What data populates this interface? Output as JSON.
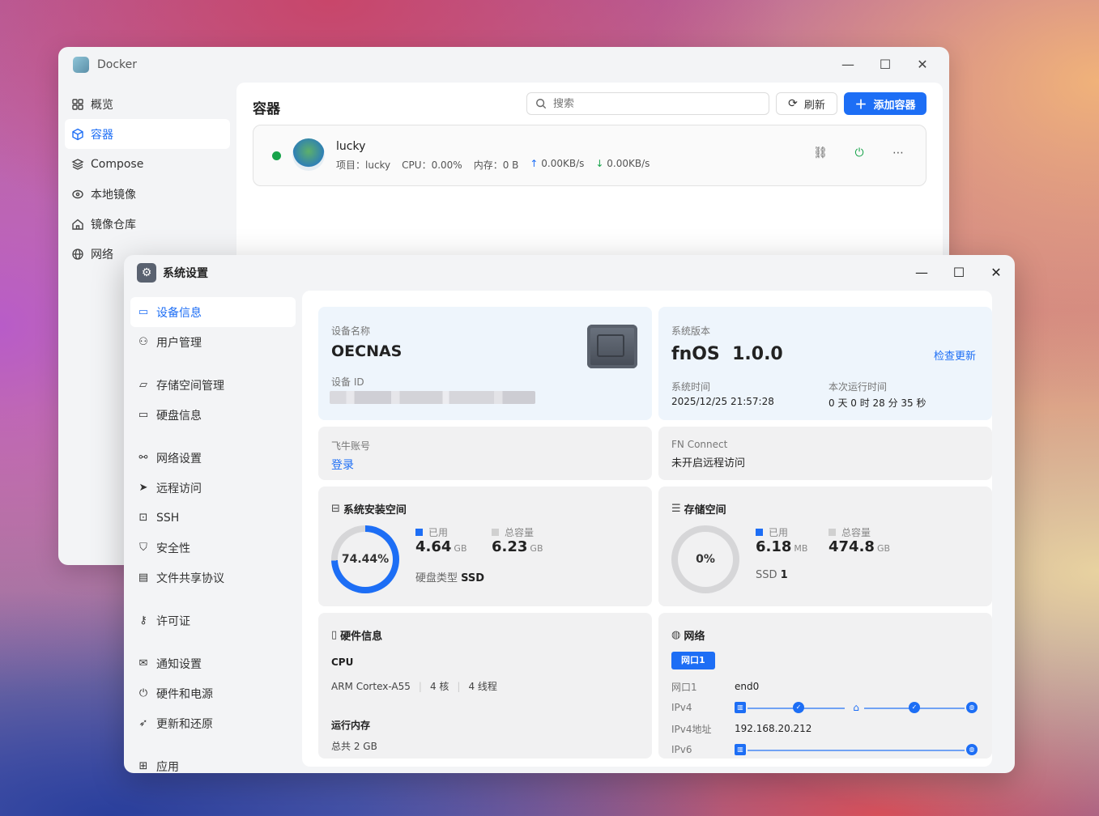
{
  "docker": {
    "title": "Docker",
    "nav": [
      {
        "label": "概览",
        "icon": "grid-icon"
      },
      {
        "label": "容器",
        "icon": "cube-icon",
        "active": true
      },
      {
        "label": "Compose",
        "icon": "layers-icon"
      },
      {
        "label": "本地镜像",
        "icon": "disc-icon"
      },
      {
        "label": "镜像仓库",
        "icon": "home-icon"
      },
      {
        "label": "网络",
        "icon": "globe-icon"
      }
    ],
    "heading": "容器",
    "search_placeholder": "搜索",
    "refresh_label": "刷新",
    "add_label": "添加容器",
    "container": {
      "name": "lucky",
      "project": "项目：lucky",
      "cpu": "CPU：0.00%",
      "memory": "内存：0 B",
      "upload": "0.00KB/s",
      "download": "0.00KB/s",
      "status_color": "#17a34a"
    }
  },
  "settings": {
    "title": "系统设置",
    "nav_groups": [
      [
        {
          "label": "设备信息",
          "icon": "device-icon",
          "active": true
        },
        {
          "label": "用户管理",
          "icon": "user-icon"
        }
      ],
      [
        {
          "label": "存储空间管理",
          "icon": "storage-icon"
        },
        {
          "label": "硬盘信息",
          "icon": "disk-icon"
        }
      ],
      [
        {
          "label": "网络设置",
          "icon": "network-icon"
        },
        {
          "label": "远程访问",
          "icon": "send-icon"
        },
        {
          "label": "SSH",
          "icon": "terminal-icon"
        },
        {
          "label": "安全性",
          "icon": "shield-icon"
        },
        {
          "label": "文件共享协议",
          "icon": "file-icon"
        }
      ],
      [
        {
          "label": "许可证",
          "icon": "key-icon"
        }
      ],
      [
        {
          "label": "通知设置",
          "icon": "mail-icon"
        },
        {
          "label": "硬件和电源",
          "icon": "power-icon"
        },
        {
          "label": "更新和还原",
          "icon": "rocket-icon"
        }
      ],
      [
        {
          "label": "应用",
          "icon": "apps-icon"
        }
      ]
    ],
    "device": {
      "name_label": "设备名称",
      "name": "OECNAS",
      "id_label": "设备 ID"
    },
    "system": {
      "version_label": "系统版本",
      "version": "fnOS  1.0.0",
      "check_update": "检查更新",
      "time_label": "系统时间",
      "time": "2025/12/25 21:57:28",
      "uptime_label": "本次运行时间",
      "uptime": "0 天 0 时 28 分 35 秒"
    },
    "account": {
      "label": "飞牛账号",
      "action": "登录"
    },
    "fn_connect": {
      "label": "FN Connect",
      "status": "未开启远程访问"
    },
    "system_space": {
      "title": "系统安装空间",
      "percent": "74.44%",
      "fraction": 0.7444,
      "used_label": "已用",
      "used": "4.64",
      "used_unit": "GB",
      "total_label": "总容量",
      "total": "6.23",
      "total_unit": "GB",
      "disk_type_label": "硬盘类型",
      "disk_type": "SSD",
      "used_color": "#1d6ef5",
      "total_color": "#d0d0d0"
    },
    "storage": {
      "title": "存储空间",
      "percent": "0%",
      "fraction": 0.0,
      "used_label": "已用",
      "used": "6.18",
      "used_unit": "MB",
      "total_label": "总容量",
      "total": "474.8",
      "total_unit": "GB",
      "ssd_label": "SSD",
      "ssd_count": "1"
    },
    "hardware": {
      "title": "硬件信息",
      "cpu_label": "CPU",
      "cpu_model": "ARM Cortex-A55",
      "cores": "4 核",
      "threads": "4 线程",
      "mem_label": "运行内存",
      "mem_total": "总共 2 GB"
    },
    "network": {
      "title": "网络",
      "port_tab": "网口1",
      "port_label": "网口1",
      "port_value": "end0",
      "ipv4_label": "IPv4",
      "ipv4_addr_label": "IPv4地址",
      "ipv4_addr": "192.168.20.212",
      "ipv6_label": "IPv6"
    }
  }
}
